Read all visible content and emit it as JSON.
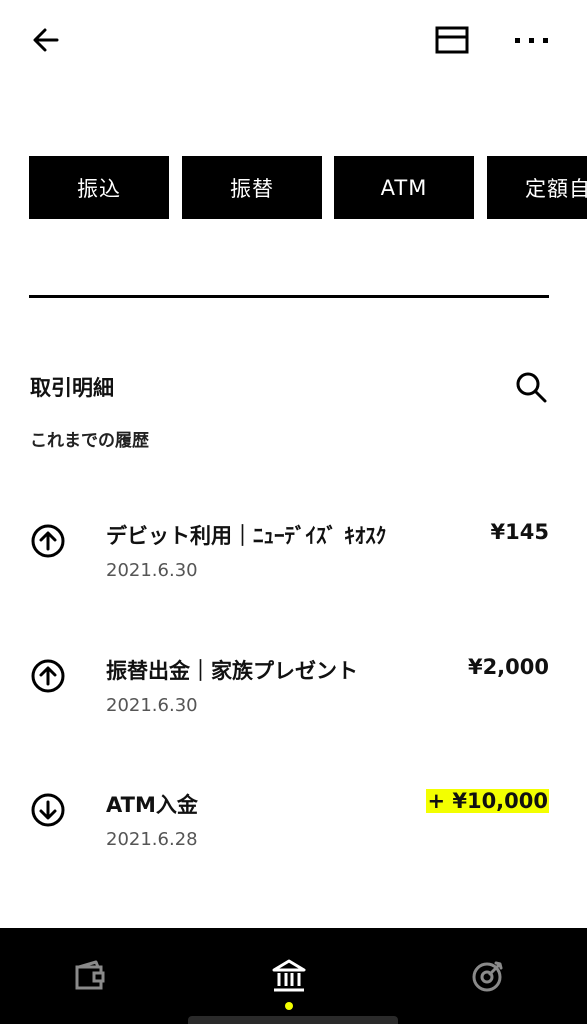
{
  "header": {
    "back_icon": "arrow-left-icon",
    "card_icon": "card-icon",
    "more_icon": "more-horizontal-icon"
  },
  "actions": [
    {
      "label": "振込"
    },
    {
      "label": "振替"
    },
    {
      "label": "ATM"
    },
    {
      "label": "定額自"
    }
  ],
  "section": {
    "title": "取引明細",
    "subtitle": "これまでの履歴",
    "search_icon": "search-icon"
  },
  "transactions": [
    {
      "direction": "out",
      "title": "デビット利用｜ﾆｭｰﾃﾞｲｽﾞ ｷｵｽｸ",
      "date": "2021.6.30",
      "amount": "¥145",
      "highlight": false
    },
    {
      "direction": "out",
      "title": "振替出金｜家族プレゼント",
      "date": "2021.6.30",
      "amount": "¥2,000",
      "highlight": false
    },
    {
      "direction": "in",
      "title": "ATM入金",
      "date": "2021.6.28",
      "amount": "+ ¥10,000",
      "highlight": true
    }
  ],
  "bottom_nav": {
    "items": [
      "wallet-icon",
      "bank-icon",
      "target-icon"
    ],
    "active": "bank-icon"
  },
  "colors": {
    "accent": "#f3ff00",
    "primary": "#000000",
    "background": "#ffffff"
  }
}
